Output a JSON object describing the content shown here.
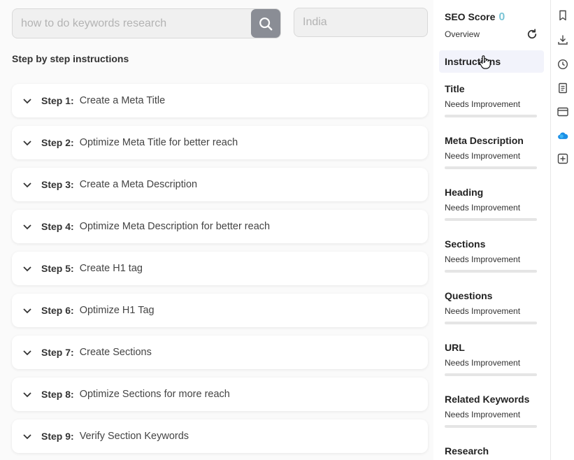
{
  "search": {
    "placeholder": "how to do keywords research",
    "value": ""
  },
  "country": {
    "placeholder": "India",
    "value": ""
  },
  "heading": "Step by step instructions",
  "steps": [
    {
      "num": "Step 1:",
      "text": "Create a Meta Title"
    },
    {
      "num": "Step 2:",
      "text": "Optimize Meta Title for better reach"
    },
    {
      "num": "Step 3:",
      "text": "Create a Meta Description"
    },
    {
      "num": "Step 4:",
      "text": "Optimize Meta Description for better reach"
    },
    {
      "num": "Step 5:",
      "text": "Create H1 tag"
    },
    {
      "num": "Step 6:",
      "text": "Optimize H1 Tag"
    },
    {
      "num": "Step 7:",
      "text": "Create Sections"
    },
    {
      "num": "Step 8:",
      "text": "Optimize Sections for more reach"
    },
    {
      "num": "Step 9:",
      "text": "Verify Section Keywords"
    }
  ],
  "panel": {
    "score_label": "SEO Score",
    "score_value": "0",
    "overview": "Overview",
    "instructions": "Instructions",
    "categories": [
      {
        "name": "Title",
        "status": "Needs Improvement"
      },
      {
        "name": "Meta Description",
        "status": "Needs Improvement"
      },
      {
        "name": "Heading",
        "status": "Needs Improvement"
      },
      {
        "name": "Sections",
        "status": "Needs Improvement"
      },
      {
        "name": "Questions",
        "status": "Needs Improvement"
      },
      {
        "name": "URL",
        "status": "Needs Improvement"
      },
      {
        "name": "Related Keywords",
        "status": "Needs Improvement"
      },
      {
        "name": "Research",
        "status": ""
      }
    ]
  },
  "colors": {
    "accent_score": "#7cc5d6",
    "search_button": "#8a8d95",
    "instructions_bg": "#f2f3fb"
  },
  "icons": {
    "search": "search-icon",
    "chevron": "chevron-down-icon",
    "refresh": "refresh-icon",
    "rail": [
      "bookmark-icon",
      "download-icon",
      "history-icon",
      "document-icon",
      "card-icon",
      "cloud-icon",
      "add-square-icon"
    ]
  }
}
